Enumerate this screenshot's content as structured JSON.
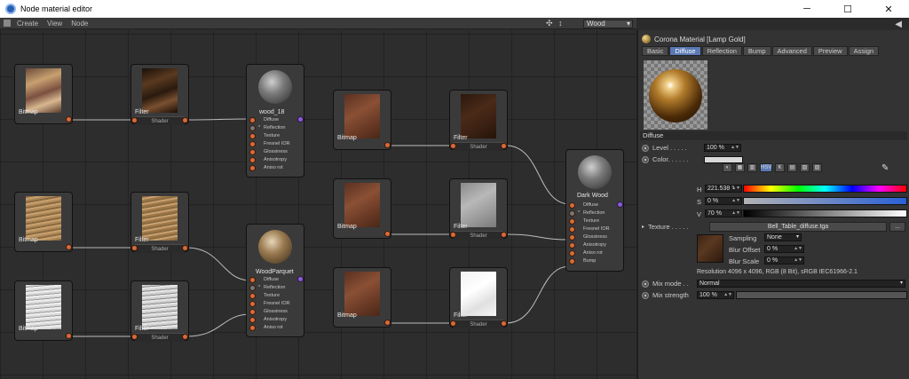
{
  "window": {
    "title": "Node material editor",
    "minimize": "─",
    "maximize": "☐",
    "close": "✕"
  },
  "menu": {
    "items": [
      "Create",
      "View",
      "Node"
    ]
  },
  "toolbar": {
    "material_select": "Wood",
    "nav_icons": "✣ ↕"
  },
  "nodes": {
    "bitmap1": {
      "label": "Bitmap"
    },
    "filter1": {
      "label": "Filter",
      "shader": "Shader"
    },
    "wood18": {
      "label": "wood_18",
      "ports": [
        "Diffuse",
        "Reflection",
        "Texture",
        "Fresnel IOR",
        "Glossiness",
        "Anisotropy",
        "Aniso rot"
      ]
    },
    "bitmap2": {
      "label": "Bitmap"
    },
    "filter2": {
      "label": "Filter",
      "shader": "Shader"
    },
    "bitmap3": {
      "label": "Bitmap"
    },
    "filter3": {
      "label": "Filter",
      "shader": "Shader"
    },
    "woodparquet": {
      "label": "WoodParquet",
      "ports": [
        "Diffuse",
        "Reflection",
        "Texture",
        "Fresnel IOR",
        "Glossiness",
        "Anisotropy",
        "Aniso rot"
      ]
    },
    "bitmap4": {
      "label": "Bitmap"
    },
    "filter4": {
      "label": "Filter",
      "shader": "Shader"
    },
    "bitmap5": {
      "label": "Bitmap"
    },
    "filter5": {
      "label": "Filter",
      "shader": "Shader"
    },
    "bitmap6": {
      "label": "Bitmap"
    },
    "filter6": {
      "label": "Filter",
      "shader": "Shader"
    },
    "darkwood": {
      "label": "Dark Wood",
      "ports": [
        "Diffuse",
        "Reflection",
        "Texture",
        "Fresnel IOR",
        "Glossiness",
        "Anisotropy",
        "Aniso rot",
        "Bump"
      ]
    }
  },
  "panel": {
    "material_title": "Corona Material [Lamp Gold]",
    "tabs": [
      "Basic",
      "Diffuse",
      "Reflection",
      "Bump",
      "Advanced",
      "Preview",
      "Assign"
    ],
    "active_tab": "Diffuse",
    "section_title": "Diffuse",
    "level_label": "Level . . . . .",
    "level_value": "100 %",
    "color_label": "Color. . . . . .",
    "color_tools": [
      "◐",
      "▦",
      "▥",
      "HSV",
      "K",
      "▤",
      "▧",
      "▨"
    ],
    "h_label": "H",
    "h_value": "221.538 °",
    "s_label": "S",
    "s_value": "0 %",
    "v_label": "V",
    "v_value": "70 %",
    "texture_label": "Texture . . . . .",
    "texture_file": "Bell_Table_diffuse.tga",
    "texture_more": "...",
    "sampling_label": "Sampling",
    "sampling_value": "None",
    "blur_offset_label": "Blur Offset",
    "blur_offset_value": "0 %",
    "blur_scale_label": "Blur Scale",
    "blur_scale_value": "0 %",
    "resolution": "Resolution 4096 x 4096, RGB (8 Bit), sRGB IEC61966-2.1",
    "mix_mode_label": "Mix mode . .",
    "mix_mode_value": "Normal",
    "mix_strength_label": "Mix strength",
    "mix_strength_value": "100 %"
  },
  "colors": {
    "accent": "#5a7ab5",
    "port_orange": "#d86a3a",
    "port_purple": "#8a5cd6"
  }
}
